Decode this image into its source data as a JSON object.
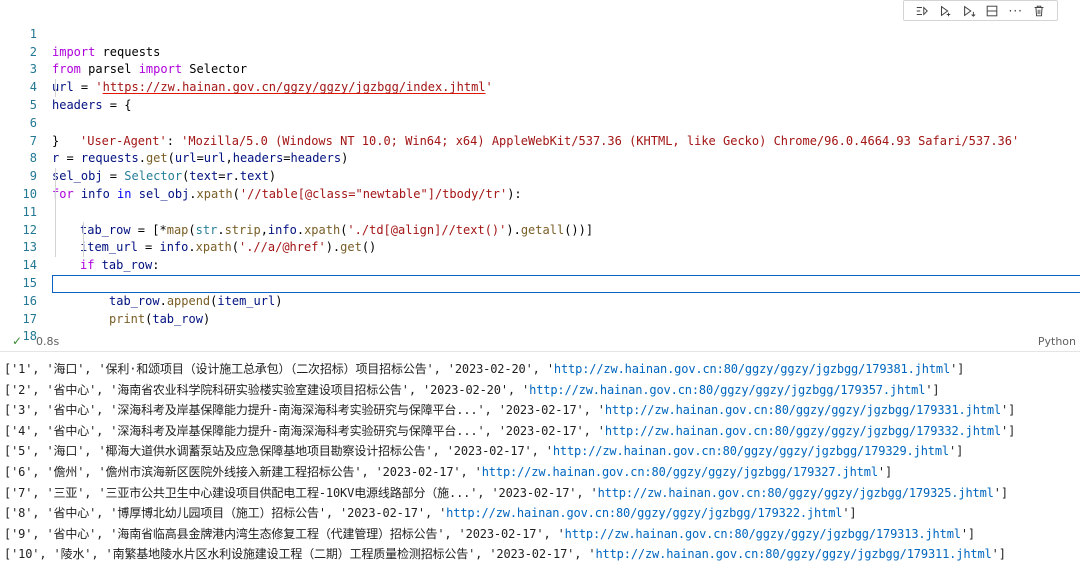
{
  "toolbar": {
    "icons": [
      "run-by-line-icon",
      "execute-above-icon",
      "execute-below-icon",
      "split-cell-icon",
      "more-icon",
      "delete-icon"
    ],
    "more_label": "···"
  },
  "code": {
    "lines": [
      {
        "n": "1"
      },
      {
        "n": "2"
      },
      {
        "n": "3"
      },
      {
        "n": "4"
      },
      {
        "n": "5"
      },
      {
        "n": "6"
      },
      {
        "n": "7"
      },
      {
        "n": "8"
      },
      {
        "n": "9"
      },
      {
        "n": "10"
      },
      {
        "n": "11"
      },
      {
        "n": "12"
      },
      {
        "n": "13"
      },
      {
        "n": "14"
      },
      {
        "n": "15"
      },
      {
        "n": "16"
      },
      {
        "n": "17"
      },
      {
        "n": "18"
      }
    ],
    "t": {
      "import": "import",
      "requests": " requests",
      "from": "from",
      "parsel": " parsel ",
      "import2": "import",
      "selector_cls": " Selector",
      "url_var": "url",
      "eq": " = ",
      "url_q1": "'",
      "url_text": "https://zw.hainan.gov.cn/ggzy/ggzy/jgzbgg/index.jhtml",
      "url_q2": "'",
      "headers_var": "headers",
      "brace_open": " = {",
      "ua_key": "'User-Agent'",
      "colon": ": ",
      "ua_val": "'Mozilla/5.0 (Windows NT 10.0; Win64; x64) AppleWebKit/537.36 (KHTML, like Gecko) Chrome/96.0.4664.93 Safari/537.36'",
      "brace_close": "}",
      "l7_r": "r",
      "l7_eq": " = ",
      "l7_requests": "requests",
      "l7_dot": ".",
      "l7_get": "get",
      "l7_p1": "(",
      "l7_url": "url",
      "l7_eq2": "=",
      "l7_url2": "url",
      "l7_c": ",",
      "l7_headers": "headers",
      "l7_eq3": "=",
      "l7_headers2": "headers",
      "l7_p2": ")",
      "l8_sel": "sel_obj",
      "l8_eq": " = ",
      "l8_cls": "Selector",
      "l8_p1": "(",
      "l8_text": "text",
      "l8_eq2": "=",
      "l8_r": "r",
      "l8_dot": ".",
      "l8_text2": "text",
      "l8_p2": ")",
      "l9_for": "for",
      "l9_info": " info ",
      "l9_in": "in",
      "l9_sel": " sel_obj",
      "l9_dot": ".",
      "l9_xpath": "xpath",
      "l9_p1": "(",
      "l9_str": "'//table[@class=\"newtable\"]/tbody/tr'",
      "l9_p2": "):",
      "l10_tab": "tab_row",
      "l10_eq": " = [",
      "l10_star": "*",
      "l10_map": "map",
      "l10_p1": "(",
      "l10_str": "str",
      "l10_dot": ".",
      "l10_strip": "strip",
      "l10_c": ",",
      "l10_info": "info",
      "l10_dot2": ".",
      "l10_xpath": "xpath",
      "l10_p2": "(",
      "l10_s": "'./td[@align]//text()'",
      "l10_p3": ").",
      "l10_getall": "getall",
      "l10_p4": "())]",
      "l11_item": "item_url",
      "l11_eq": " = ",
      "l11_info": "info",
      "l11_dot": ".",
      "l11_xpath": "xpath",
      "l11_p1": "(",
      "l11_s": "'.//a/@href'",
      "l11_p2": ").",
      "l11_get": "get",
      "l11_p3": "()",
      "l12_if": "if",
      "l12_tab": " tab_row",
      "l12_c": ":",
      "l13_tab": "tab_row",
      "l13_dot": ".",
      "l13_append": "append",
      "l13_p1": "(",
      "l13_item": "item_url",
      "l13_p2": ")",
      "l14_print": "print",
      "l14_p1": "(",
      "l14_tab": "tab_row",
      "l14_p2": ")"
    }
  },
  "status": {
    "check_icon": "check-icon",
    "time": "0.8s",
    "language": "Python"
  },
  "output": {
    "rows": [
      {
        "prefix": "['1', '海口', '保利·和颂项目（设计施工总承包）（二次招标）项目招标公告', '2023-02-20', '",
        "url": "http://zw.hainan.gov.cn:80/ggzy/ggzy/jgzbgg/179381.jhtml",
        "suffix": "']"
      },
      {
        "prefix": "['2', '省中心', '海南省农业科学院科研实验楼实验室建设项目招标公告', '2023-02-20', '",
        "url": "http://zw.hainan.gov.cn:80/ggzy/ggzy/jgzbgg/179357.jhtml",
        "suffix": "']"
      },
      {
        "prefix": "['3', '省中心', '深海科考及岸基保障能力提升-南海深海科考实验研究与保障平台...', '2023-02-17', '",
        "url": "http://zw.hainan.gov.cn:80/ggzy/ggzy/jgzbgg/179331.jhtml",
        "suffix": "']"
      },
      {
        "prefix": "['4', '省中心', '深海科考及岸基保障能力提升-南海深海科考实验研究与保障平台...', '2023-02-17', '",
        "url": "http://zw.hainan.gov.cn:80/ggzy/ggzy/jgzbgg/179332.jhtml",
        "suffix": "']"
      },
      {
        "prefix": "['5', '海口', '椰海大道供水调蓄泵站及应急保障基地项目勘察设计招标公告', '2023-02-17', '",
        "url": "http://zw.hainan.gov.cn:80/ggzy/ggzy/jgzbgg/179329.jhtml",
        "suffix": "']"
      },
      {
        "prefix": "['6', '儋州', '儋州市滨海新区医院外线接入新建工程招标公告', '2023-02-17', '",
        "url": "http://zw.hainan.gov.cn:80/ggzy/ggzy/jgzbgg/179327.jhtml",
        "suffix": "']"
      },
      {
        "prefix": "['7', '三亚', '三亚市公共卫生中心建设项目供配电工程-10KV电源线路部分（施...', '2023-02-17', '",
        "url": "http://zw.hainan.gov.cn:80/ggzy/ggzy/jgzbgg/179325.jhtml",
        "suffix": "']"
      },
      {
        "prefix": "['8', '省中心', '博厚博北幼儿园项目（施工）招标公告', '2023-02-17', '",
        "url": "http://zw.hainan.gov.cn:80/ggzy/ggzy/jgzbgg/179322.jhtml",
        "suffix": "']"
      },
      {
        "prefix": "['9', '省中心', '海南省临高县金牌港内湾生态修复工程（代建管理）招标公告', '2023-02-17', '",
        "url": "http://zw.hainan.gov.cn:80/ggzy/ggzy/jgzbgg/179313.jhtml",
        "suffix": "']"
      },
      {
        "prefix": "['10', '陵水', '南繁基地陵水片区水利设施建设工程（二期）工程质量检测招标公告', '2023-02-17', '",
        "url": "http://zw.hainan.gov.cn:80/ggzy/ggzy/jgzbgg/179311.jhtml",
        "suffix": "']"
      }
    ]
  }
}
